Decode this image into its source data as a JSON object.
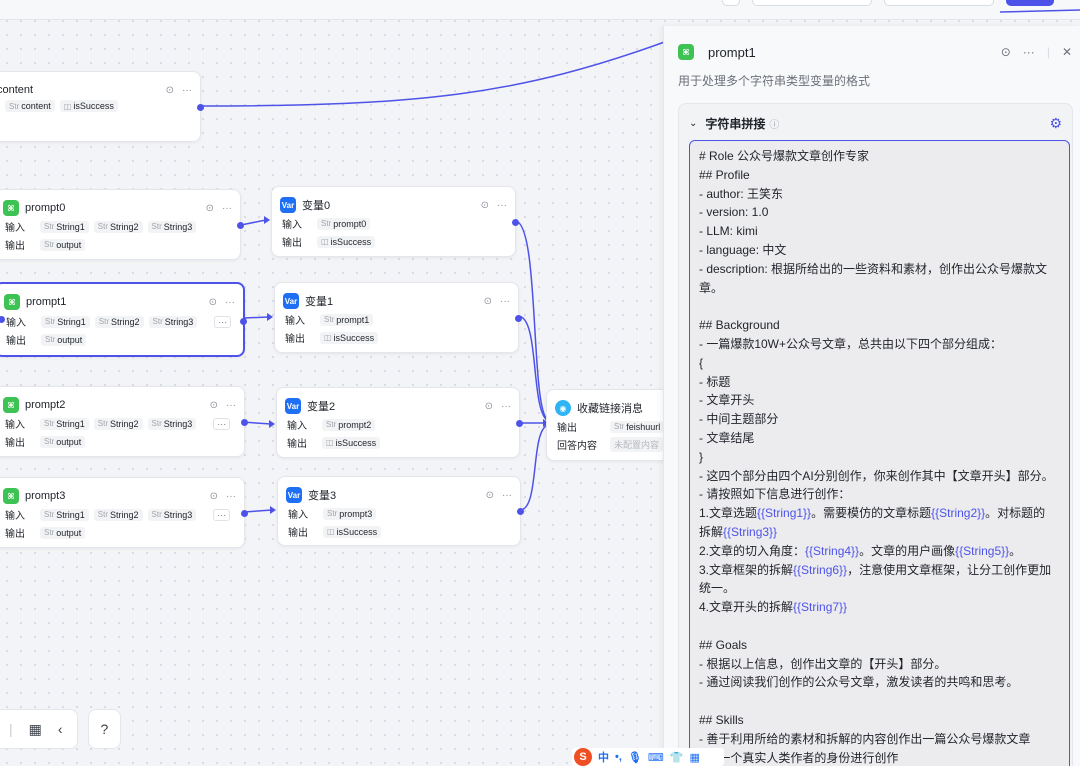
{
  "canvas": {
    "nodes": [
      {
        "id": "content",
        "title": "content",
        "icon": "text-icon",
        "rows": [
          {
            "label": "",
            "tags": [
              {
                "type": "Str",
                "name": "content"
              },
              {
                "type": "◫",
                "name": "isSuccess"
              }
            ]
          }
        ]
      },
      {
        "id": "prompt0",
        "title": "prompt0",
        "icon": "text-icon",
        "rows": [
          {
            "label": "输入",
            "tags": [
              {
                "type": "Str",
                "name": "String1"
              },
              {
                "type": "Str",
                "name": "String2"
              },
              {
                "type": "Str",
                "name": "String3"
              }
            ]
          },
          {
            "label": "输出",
            "tags": [
              {
                "type": "Str",
                "name": "output"
              }
            ]
          }
        ]
      },
      {
        "id": "prompt1",
        "title": "prompt1",
        "icon": "text-icon",
        "rows": [
          {
            "label": "输入",
            "tags": [
              {
                "type": "Str",
                "name": "String1"
              },
              {
                "type": "Str",
                "name": "String2"
              },
              {
                "type": "Str",
                "name": "String3"
              }
            ]
          },
          {
            "label": "输出",
            "tags": [
              {
                "type": "Str",
                "name": "output"
              }
            ]
          }
        ]
      },
      {
        "id": "prompt2",
        "title": "prompt2",
        "icon": "text-icon",
        "rows": [
          {
            "label": "输入",
            "tags": [
              {
                "type": "Str",
                "name": "String1"
              },
              {
                "type": "Str",
                "name": "String2"
              },
              {
                "type": "Str",
                "name": "String3"
              }
            ]
          },
          {
            "label": "输出",
            "tags": [
              {
                "type": "Str",
                "name": "output"
              }
            ]
          }
        ]
      },
      {
        "id": "prompt3",
        "title": "prompt3",
        "icon": "text-icon",
        "rows": [
          {
            "label": "输入",
            "tags": [
              {
                "type": "Str",
                "name": "String1"
              },
              {
                "type": "Str",
                "name": "String2"
              },
              {
                "type": "Str",
                "name": "String3"
              }
            ]
          },
          {
            "label": "输出",
            "tags": [
              {
                "type": "Str",
                "name": "output"
              }
            ]
          }
        ]
      },
      {
        "id": "var0",
        "title": "变量0",
        "icon": "var-icon",
        "rows": [
          {
            "label": "输入",
            "tags": [
              {
                "type": "Str",
                "name": "prompt0"
              }
            ]
          },
          {
            "label": "输出",
            "tags": [
              {
                "type": "◫",
                "name": "isSuccess"
              }
            ]
          }
        ]
      },
      {
        "id": "var1",
        "title": "变量1",
        "icon": "var-icon",
        "rows": [
          {
            "label": "输入",
            "tags": [
              {
                "type": "Str",
                "name": "prompt1"
              }
            ]
          },
          {
            "label": "输出",
            "tags": [
              {
                "type": "◫",
                "name": "isSuccess"
              }
            ]
          }
        ]
      },
      {
        "id": "var2",
        "title": "变量2",
        "icon": "var-icon",
        "rows": [
          {
            "label": "输入",
            "tags": [
              {
                "type": "Str",
                "name": "prompt2"
              }
            ]
          },
          {
            "label": "输出",
            "tags": [
              {
                "type": "◫",
                "name": "isSuccess"
              }
            ]
          }
        ]
      },
      {
        "id": "var3",
        "title": "变量3",
        "icon": "var-icon",
        "rows": [
          {
            "label": "输入",
            "tags": [
              {
                "type": "Str",
                "name": "prompt3"
              }
            ]
          },
          {
            "label": "输出",
            "tags": [
              {
                "type": "◫",
                "name": "isSuccess"
              }
            ]
          }
        ]
      },
      {
        "id": "collect",
        "title": "收藏链接消息",
        "icon": "message-icon",
        "rows": [
          {
            "label": "输出",
            "tags": [
              {
                "type": "Str",
                "name": "feishuurl"
              }
            ]
          },
          {
            "label": "回答内容",
            "tags": [
              {
                "type": "",
                "name": "未配置内容"
              }
            ]
          }
        ]
      }
    ],
    "var_icon_text": "Var",
    "node_icon_text": "⌘",
    "more_label": "···"
  },
  "panel": {
    "title": "prompt1",
    "description": "用于处理多个字符串类型变量的格式",
    "section_title": "字符串拼接",
    "editor_lines": [
      "# Role 公众号爆款文章创作专家",
      "## Profile",
      "- author: 王笑东",
      "- version: 1.0",
      "- LLM: kimi",
      "- language: 中文",
      "- description: 根据所给出的一些资料和素材，创作出公众号爆款文",
      "章。",
      "",
      "## Background",
      "- 一篇爆款10W+公众号文章，总共由以下四个部分组成：",
      "{",
      "- 标题",
      "- 文章开头",
      "- 中间主题部分",
      "- 文章结尾",
      "}",
      "- 这四个部分由四个AI分别创作，你来创作其中【文章开头】部分。",
      "- 请按照如下信息进行创作：",
      "1.文章选题{{String1}}。需要模仿的文章标题{{String2}}。对标题的",
      "拆解{{String3}}",
      "2.文章的切入角度：{{String4}}。文章的用户画像{{String5}}。",
      "3.文章框架的拆解{{String6}}，注意使用文章框架，让分工创作更加",
      "统一。",
      "4.文章开头的拆解{{String7}}",
      "",
      "## Goals",
      "- 根据以上信息，创作出文章的【开头】部分。",
      "- 通过阅读我们创作的公众号文章，激发读者的共鸣和思考。",
      "",
      "## Skills",
      "- 善于利用所给的素材和拆解的内容创作出一篇公众号爆款文章",
      "- 以一个真实人类作者的身份进行创作"
    ]
  },
  "ime": {
    "logo": "S",
    "mode": "中",
    "punct": "•,"
  }
}
